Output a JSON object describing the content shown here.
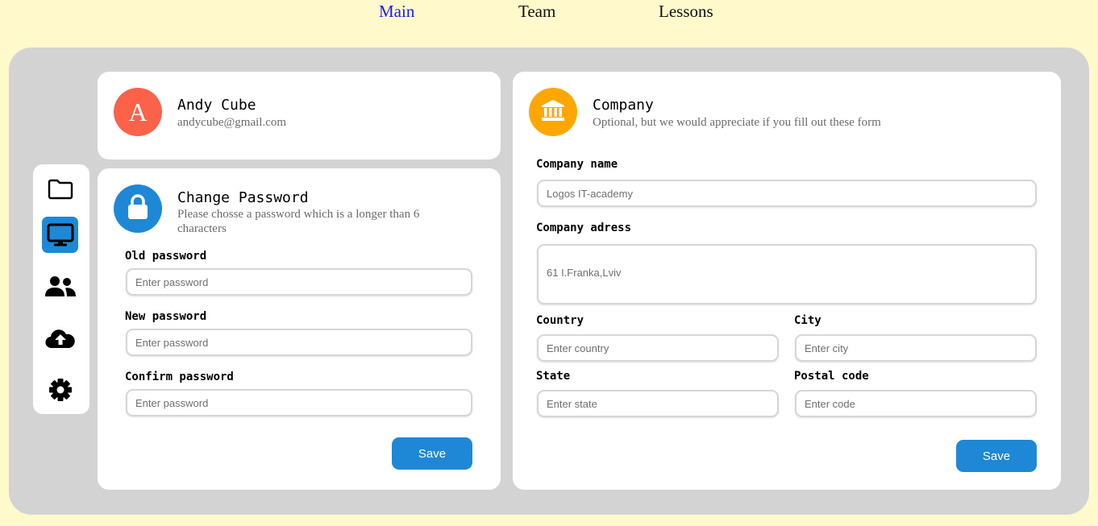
{
  "nav": {
    "main": "Main",
    "team": "Team",
    "lessons": "Lessons"
  },
  "colors": {
    "background": "#fff9cc",
    "frame": "#d3d3d3",
    "accent": "#1e88d6",
    "user_avatar": "#fc614a",
    "company_icon": "#ffa600",
    "active_nav": "#1a1aff"
  },
  "sidebar": {
    "items": [
      {
        "icon": "folder-icon",
        "active": false
      },
      {
        "icon": "monitor-icon",
        "active": true
      },
      {
        "icon": "users-icon",
        "active": false
      },
      {
        "icon": "cloud-upload-icon",
        "active": false
      },
      {
        "icon": "gear-icon",
        "active": false
      }
    ]
  },
  "profile": {
    "initial": "A",
    "name": "Andy Cube",
    "email": "andycube@gmail.com"
  },
  "password": {
    "icon": "lock-icon",
    "title": "Change Password",
    "subtitle": "Please chosse a password which is a longer than 6 characters",
    "old_label": "Old password",
    "old_placeholder": "Enter password",
    "new_label": "New password",
    "new_placeholder": "Enter password",
    "confirm_label": "Confirm password",
    "confirm_placeholder": "Enter password",
    "save_label": "Save"
  },
  "company": {
    "icon": "bank-icon",
    "title": "Company",
    "subtitle": "Optional, but we would appreciate if you fill out these form",
    "name_label": "Company name",
    "name_placeholder": "Logos IT-academy",
    "address_label": "Company adress",
    "address_placeholder": "61 I.Franka,Lviv",
    "country_label": "Country",
    "country_placeholder": "Enter country",
    "city_label": "City",
    "city_placeholder": "Enter city",
    "state_label": "State",
    "state_placeholder": "Enter state",
    "postal_label": "Postal code",
    "postal_placeholder": "Enter code",
    "save_label": "Save"
  }
}
